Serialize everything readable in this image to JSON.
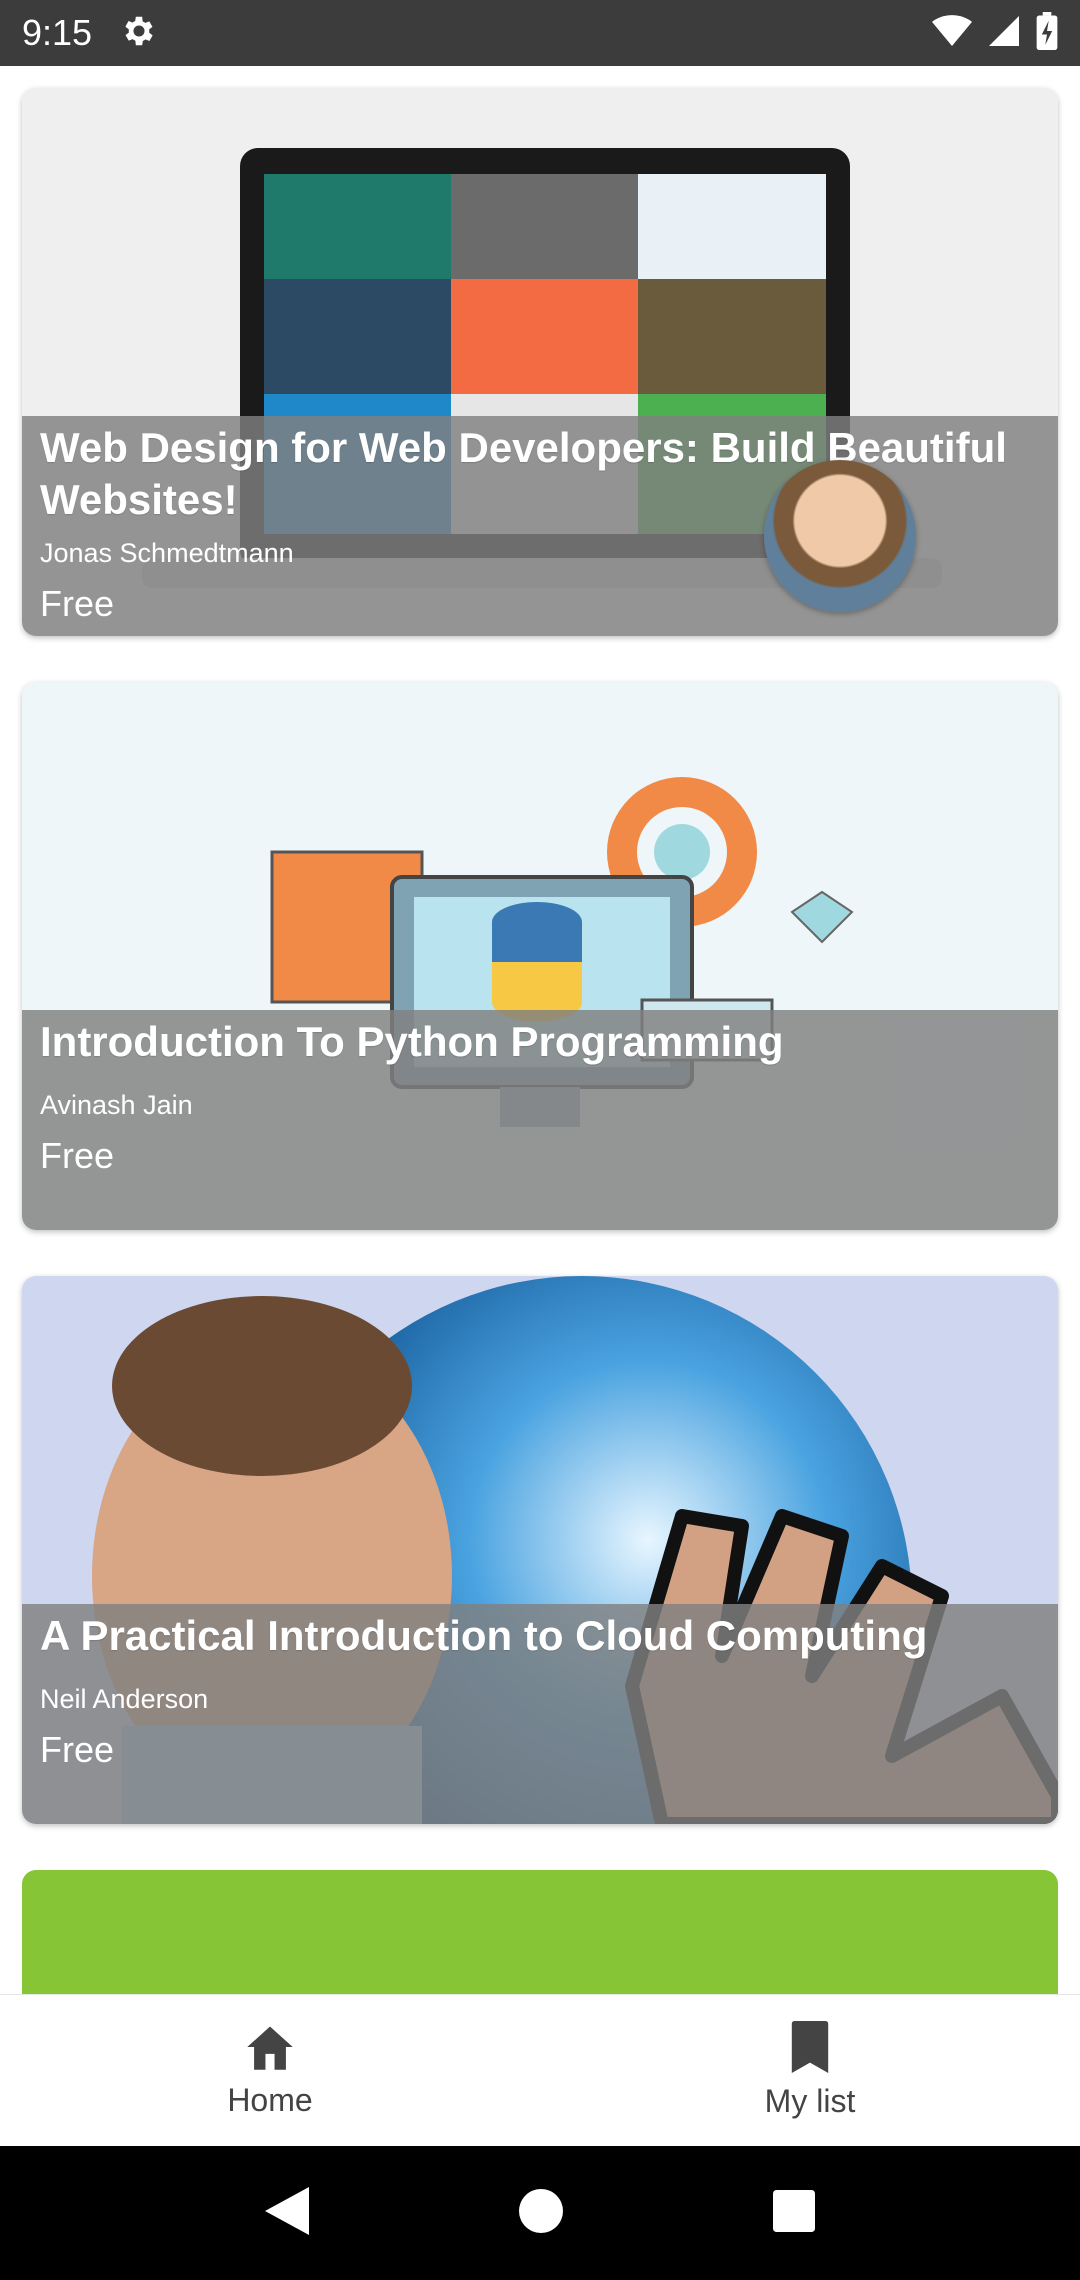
{
  "status_bar": {
    "time": "9:15"
  },
  "courses": [
    {
      "title": "Web Design for Web Developers: Build Beautiful Websites!",
      "author": "Jonas Schmedtmann",
      "price": "Free"
    },
    {
      "title": "Introduction To Python Programming",
      "author": "Avinash Jain",
      "price": "Free"
    },
    {
      "title": "A Practical Introduction to Cloud Computing",
      "author": "Neil Anderson",
      "price": "Free"
    }
  ],
  "bottom_nav": {
    "home_label": "Home",
    "mylist_label": "My list"
  },
  "colors": {
    "status_bar": "#3c3c3c",
    "overlay": "#808080",
    "green_card": "#86c535",
    "python_blue": "#3b79b4",
    "python_yellow": "#f6c844",
    "accent_orange": "#f08a46"
  },
  "icons": [
    "settings-icon",
    "wifi-icon",
    "signal-icon",
    "battery-icon",
    "home-icon",
    "bookmark-icon",
    "back-icon",
    "home-circle-icon",
    "recents-icon"
  ]
}
